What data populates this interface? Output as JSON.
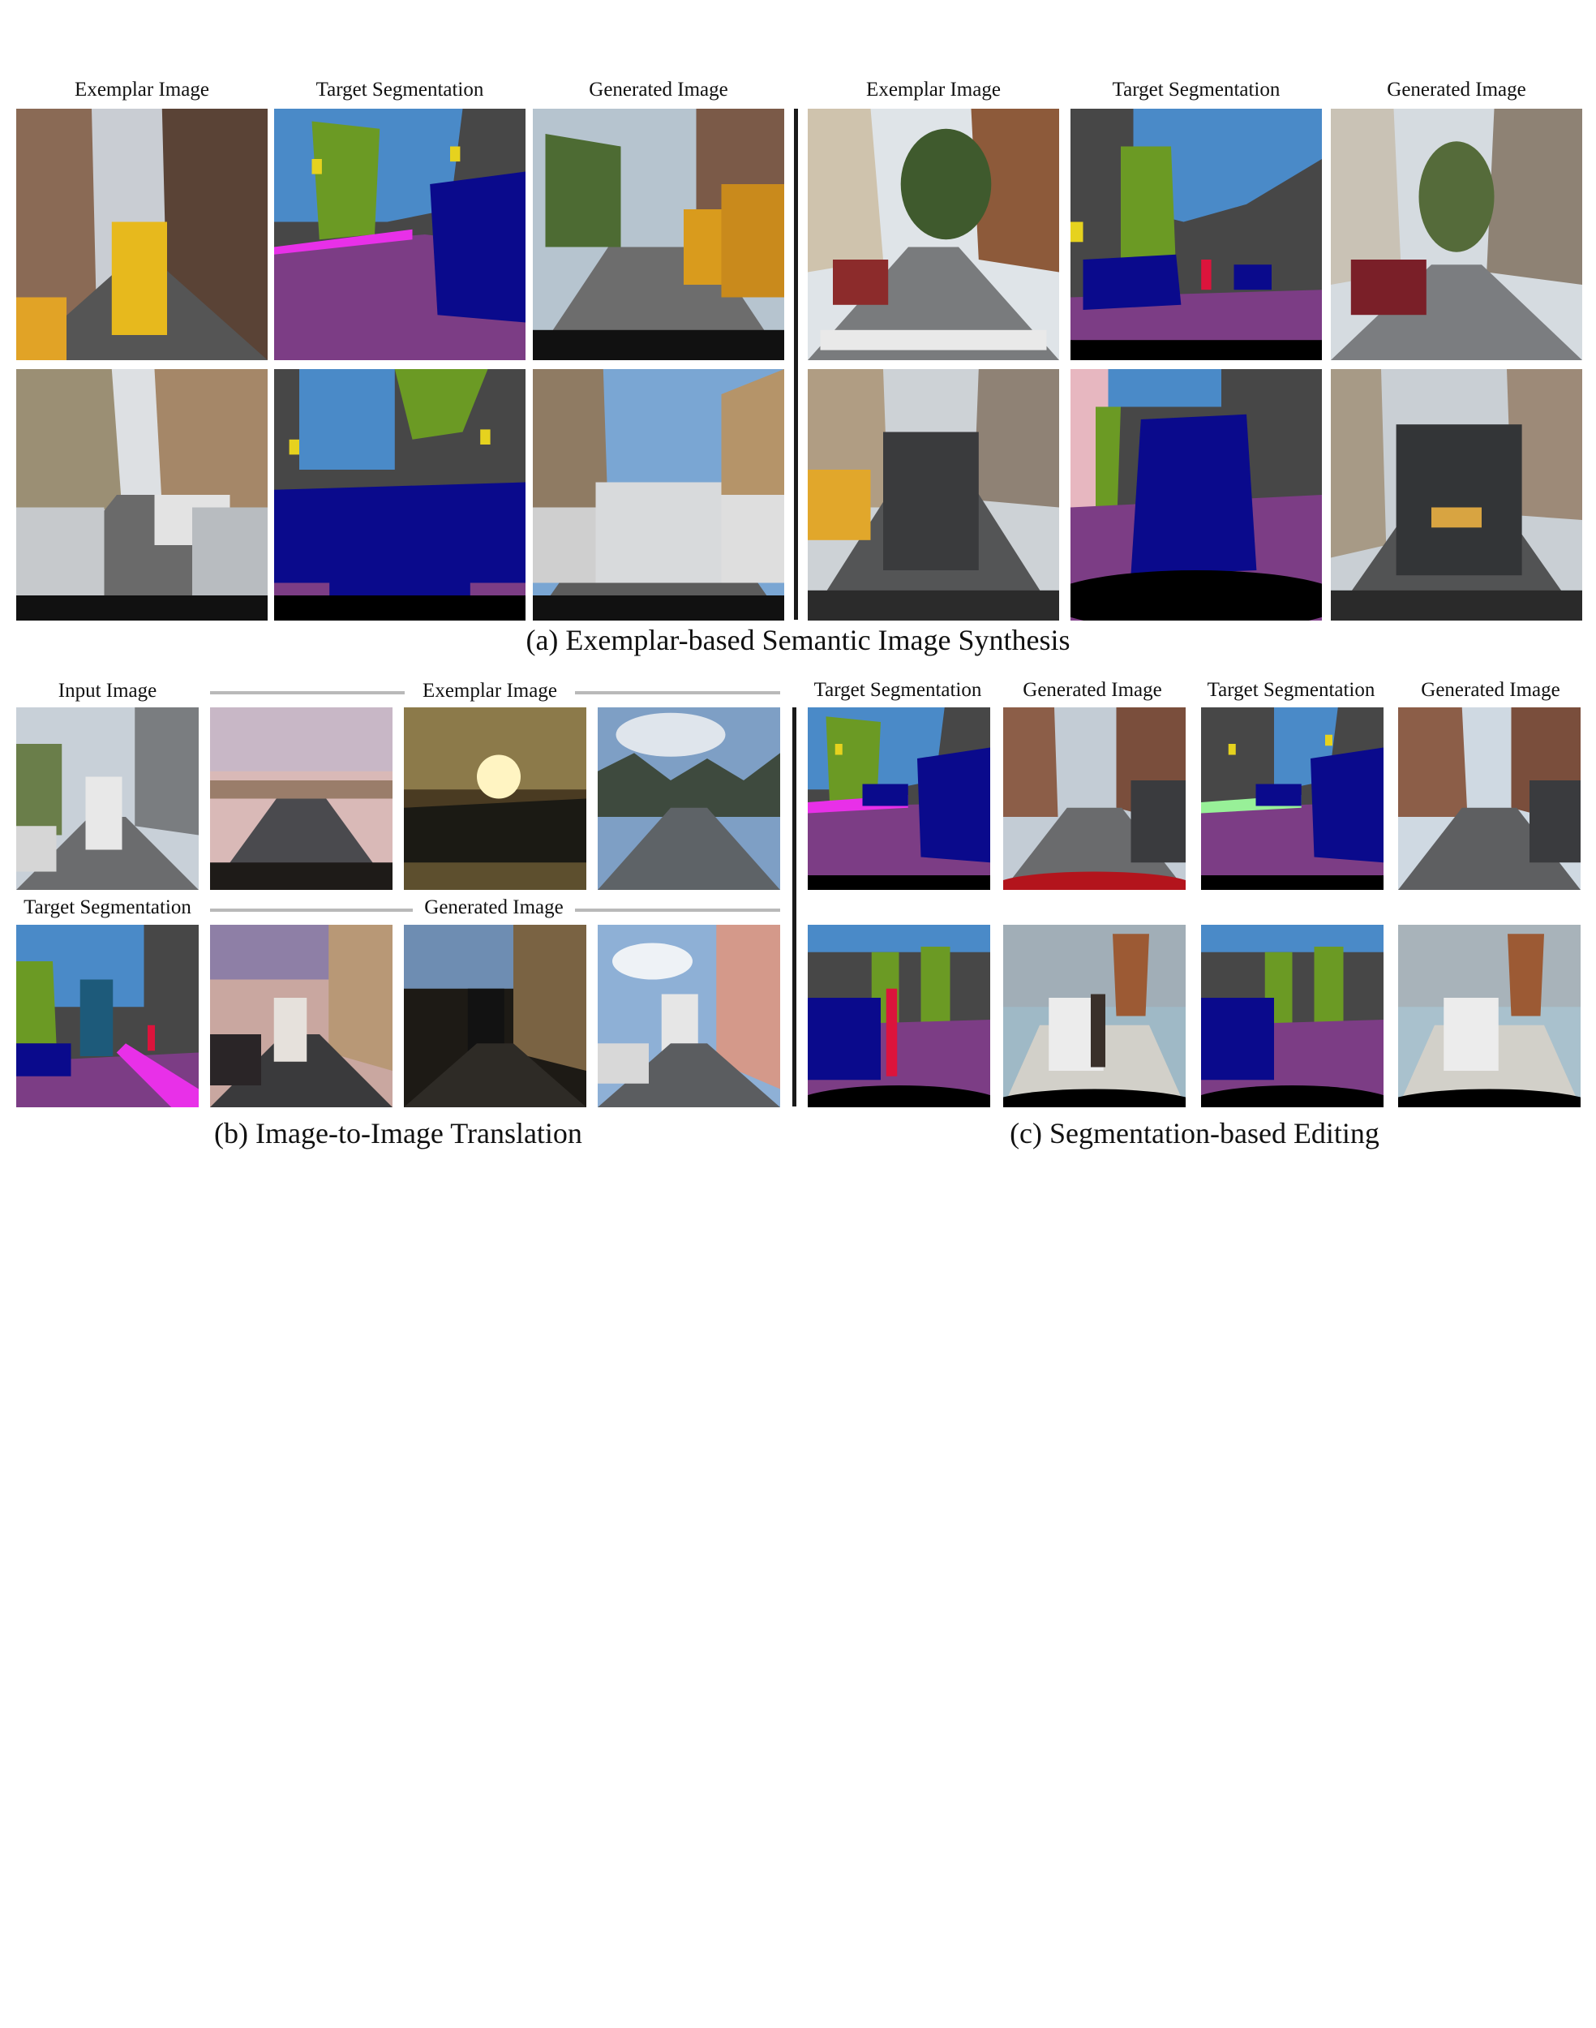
{
  "section_a": {
    "caption": "(a)  Exemplar-based Semantic Image Synthesis",
    "left_headers": [
      "Exemplar Image",
      "Target Segmentation",
      "Generated Image"
    ],
    "right_headers": [
      "Exemplar Image",
      "Target Segmentation",
      "Generated Image"
    ]
  },
  "section_b": {
    "caption": "(b) Image-to-Image Translation",
    "input_label": "Input Image",
    "exemplar_label": "Exemplar Image",
    "target_label": "Target Segmentation",
    "generated_label": "Generated Image"
  },
  "section_c": {
    "caption": "(c) Segmentation-based Editing",
    "headers": [
      "Target Segmentation",
      "Generated Image",
      "Target Segmentation",
      "Generated Image"
    ]
  },
  "colors": {
    "seg_sky": "#4a8ac8",
    "seg_building": "#474747",
    "seg_vegetation": "#6b9a24",
    "seg_road": "#7c3d85",
    "seg_car": "#0a0a8c",
    "seg_sidewalk": "#e830e8",
    "seg_sign": "#e6d21e",
    "seg_person": "#dc143c",
    "seg_ego": "#000000",
    "divider": "#1a1a1a",
    "rule": "#b9b9b9"
  }
}
